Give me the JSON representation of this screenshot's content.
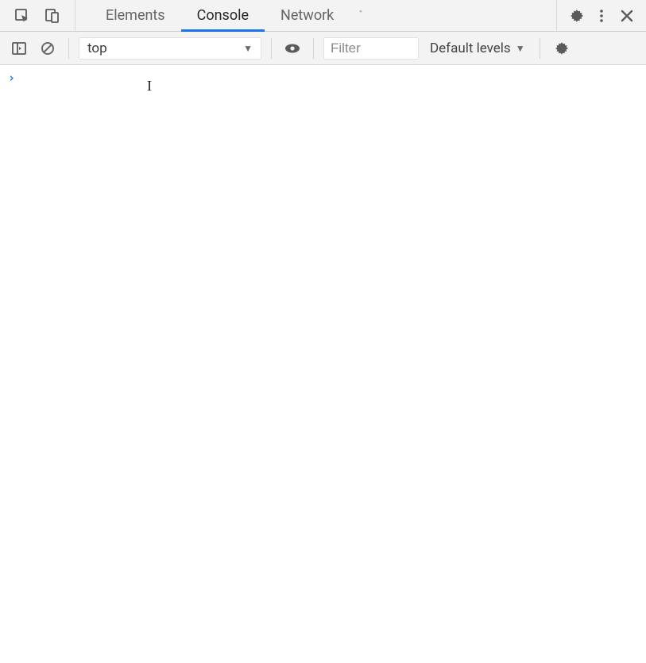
{
  "tabbar": {
    "tabs": [
      {
        "label": "Elements",
        "active": false
      },
      {
        "label": "Console",
        "active": true
      },
      {
        "label": "Network",
        "active": false
      }
    ]
  },
  "toolbar": {
    "context_value": "top",
    "filter_placeholder": "Filter",
    "levels_label": "Default levels"
  },
  "console": {
    "prompt_marker": "›"
  }
}
